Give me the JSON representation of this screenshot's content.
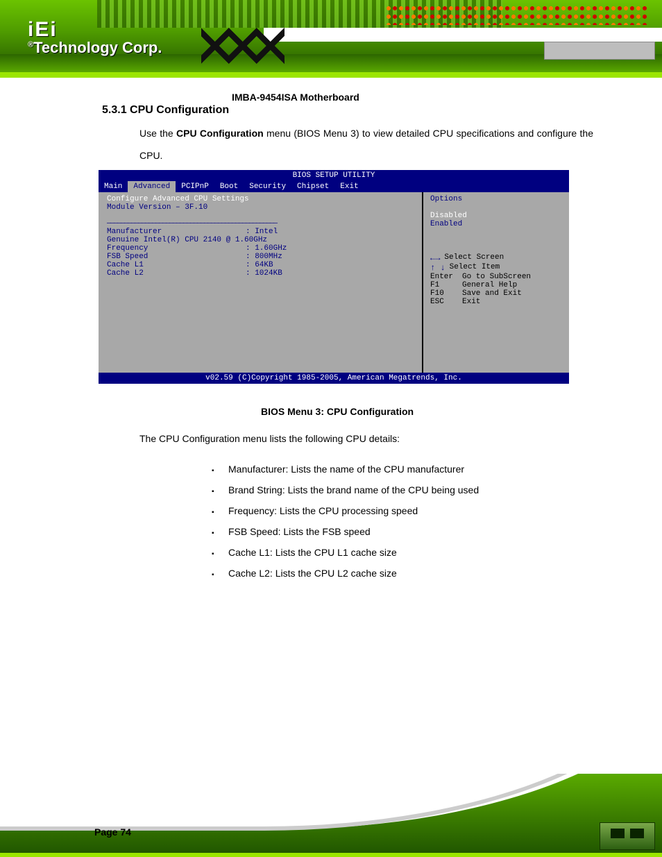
{
  "logo": {
    "brand": "iEi",
    "reg": "®",
    "sub": "Technology Corp."
  },
  "doc_title": "IMBA-9454ISA Motherboard",
  "section_heading": "5.3.1 CPU Configuration",
  "para1_a": "Use the ",
  "para1_b": "CPU Configuration",
  "para1_c": " menu (BIOS Menu 3) to view detailed CPU specifications and configure the CPU.",
  "bios": {
    "title": "BIOS SETUP UTILITY",
    "tabs": {
      "main": "Main",
      "advanced": "Advanced",
      "pcipnp": "PCIPnP",
      "boot": "Boot",
      "security": "Security",
      "chipset": "Chipset",
      "exit": "Exit"
    },
    "module_hdr": "Configure Advanced CPU Settings",
    "module_ver": "Module Version – 3F.10",
    "divider": "—————————————————————————————————————————————————",
    "mfr": {
      "k": "Manufacturer",
      "v": ": Intel"
    },
    "brand": "Genuine Intel(R) CPU  2140 @ 1.60GHz",
    "freq": {
      "k": "Frequency",
      "v": ": 1.60GHz"
    },
    "fsb": {
      "k": "FSB Speed",
      "v": ": 800MHz"
    },
    "l1": {
      "k": "Cache L1",
      "v": ": 64KB"
    },
    "l2": {
      "k": "Cache L2",
      "v": ": 1024KB"
    },
    "help_hdr": "Options",
    "disabled": "Disabled",
    "enabled": "Enabled",
    "nav": {
      "lr": "Select Screen",
      "ud": "Select Item",
      "enter": {
        "k": "Enter",
        "v": "Go to SubScreen"
      },
      "f1": {
        "k": "F1",
        "v": "General Help"
      },
      "f10": {
        "k": "F10",
        "v": "Save and Exit"
      },
      "esc": {
        "k": "ESC",
        "v": "Exit"
      }
    },
    "status": "v02.59 (C)Copyright 1985-2005, American Megatrends, Inc."
  },
  "caption": "BIOS Menu 3: CPU Configuration",
  "para2": "The CPU Configuration menu lists the following CPU details:",
  "bullets": [
    "Manufacturer: Lists the name of the CPU manufacturer",
    "Brand String: Lists the brand name of the CPU being used",
    "Frequency: Lists the CPU processing speed",
    "FSB Speed: Lists the FSB speed",
    "Cache L1: Lists the CPU L1 cache size",
    "Cache L2: Lists the CPU L2 cache size"
  ],
  "page_number": "Page 74"
}
